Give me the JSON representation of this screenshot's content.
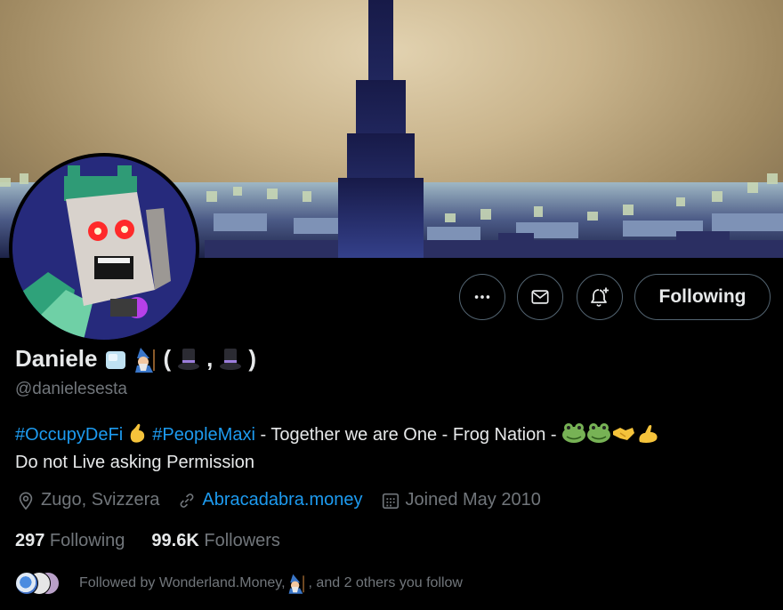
{
  "profile": {
    "name": "Daniele",
    "name_suffix": "(",
    "name_comma": ",",
    "name_close": ")",
    "handle": "@danielesesta"
  },
  "actions": {
    "more_icon": "more-icon",
    "message_icon": "envelope-icon",
    "notify_icon": "bell-plus-icon",
    "follow_label": "Following"
  },
  "bio": {
    "tag1": "#OccupyDeFi",
    "tag2": "#PeopleMaxi",
    "text1": " - Together we are One - Frog Nation - ",
    "line2": "Do not Live asking Permission"
  },
  "meta": {
    "location": "Zugo, Svizzera",
    "website": "Abracadabra.money",
    "joined": "Joined May 2010"
  },
  "stats": {
    "following_count": "297",
    "following_label": " Following",
    "followers_count": "99.6K",
    "followers_label": " Followers"
  },
  "followed_by": {
    "text1": "Followed by Wonderland.Money, ",
    "text2": ", and 2 others you follow"
  },
  "colors": {
    "accent": "#1d9bf0",
    "muted": "#71767b",
    "text": "#e7e9ea",
    "border": "#536471"
  }
}
